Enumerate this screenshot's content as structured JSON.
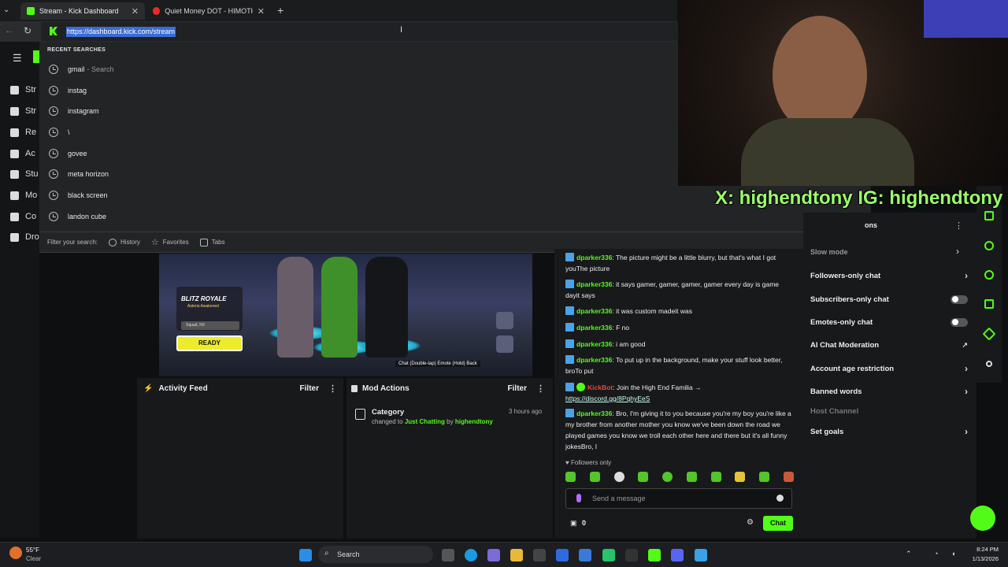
{
  "browser": {
    "tabs": [
      {
        "label": "Stream - Kick Dashboard",
        "active": true
      },
      {
        "label": "Quiet Money DOT - HIMOTHY (IN",
        "active": false
      }
    ],
    "url": "https://dashboard.kick.com/stream"
  },
  "omnibox_dropdown": {
    "heading": "RECENT SEARCHES",
    "suggestions": [
      {
        "text": "gmail",
        "hint": "- Search"
      },
      {
        "text": "instag",
        "hint": ""
      },
      {
        "text": "instagram",
        "hint": ""
      },
      {
        "text": "\\",
        "hint": ""
      },
      {
        "text": "govee",
        "hint": ""
      },
      {
        "text": "meta horizon",
        "hint": ""
      },
      {
        "text": "black screen",
        "hint": ""
      },
      {
        "text": "landon cube",
        "hint": ""
      }
    ],
    "filter_label": "Filter your search:",
    "filters": [
      "History",
      "Favorites",
      "Tabs"
    ]
  },
  "sidebar": {
    "items": [
      "Str",
      "Str",
      "Re",
      "Ac",
      "Stu",
      "Mo",
      "Co",
      "Dro"
    ]
  },
  "preview": {
    "mode_title": "BLITZ ROYALE",
    "mode_sub": "Asteria Awakened",
    "squad": "Squad, Fill",
    "ready": "READY",
    "hint": "Chat (Double-tap)  Emote (Hold)  Back"
  },
  "activity_feed": {
    "title": "Activity Feed",
    "filter": "Filter"
  },
  "mod_actions": {
    "title": "Mod Actions",
    "filter": "Filter",
    "item": {
      "title": "Category",
      "time": "3 hours ago",
      "prefix": "changed to",
      "category": "Just Chatting",
      "by": "by",
      "user": "highendtony"
    }
  },
  "chat": {
    "messages": [
      {
        "user": "dparker336",
        "text": "The picture might be a little blurry, but that's what I got youThe picture"
      },
      {
        "user": "dparker336",
        "text": "it says gamer, gamer, gamer, gamer every day is game dayit says"
      },
      {
        "user": "dparker336",
        "text": "it was custom madeit was"
      },
      {
        "user": "dparker336",
        "text": "F no"
      },
      {
        "user": "dparker336",
        "text": "i am good"
      },
      {
        "user": "dparker336",
        "text": "To put up in the background, make your stuff look better, broTo put"
      },
      {
        "user": "KickBot",
        "text": "Join the High End Familia →",
        "link": "https://discord.gg/8PqhyEeS"
      },
      {
        "user": "dparker336",
        "text": "Bro, I'm giving it to you because you're my boy you're like a my brother from another mother you know we've been down the road we played games you know we troll each other here and there but it's all funny jokesBro, I"
      }
    ],
    "followers_only": "Followers only",
    "input_placeholder": "Send a message",
    "viewer_count": "0",
    "send_label": "Chat"
  },
  "settings": {
    "partial_top": "ons",
    "partial_slow": "Slow mode",
    "rows": [
      {
        "label": "Followers-only chat",
        "control": "chevron"
      },
      {
        "label": "Subscribers-only chat",
        "control": "toggle"
      },
      {
        "label": "Emotes-only chat",
        "control": "toggle"
      },
      {
        "label": "AI Chat Moderation",
        "control": "external"
      },
      {
        "label": "Account age restriction",
        "control": "chevron"
      },
      {
        "label": "Banned words",
        "control": "chevron"
      },
      {
        "label": "Host Channel",
        "control": "none"
      },
      {
        "label": "Set goals",
        "control": "chevron"
      }
    ]
  },
  "webcam": {
    "overlay": "X: highendtony IG: highendtony"
  },
  "taskbar": {
    "weather_temp": "55°F",
    "weather_desc": "Clear",
    "search": "Search",
    "time": "8:24 PM",
    "date": "1/13/2026"
  },
  "colors": {
    "accent": "#53fc18",
    "chat_user": "#53fc18",
    "bot_user": "#e9473c"
  }
}
